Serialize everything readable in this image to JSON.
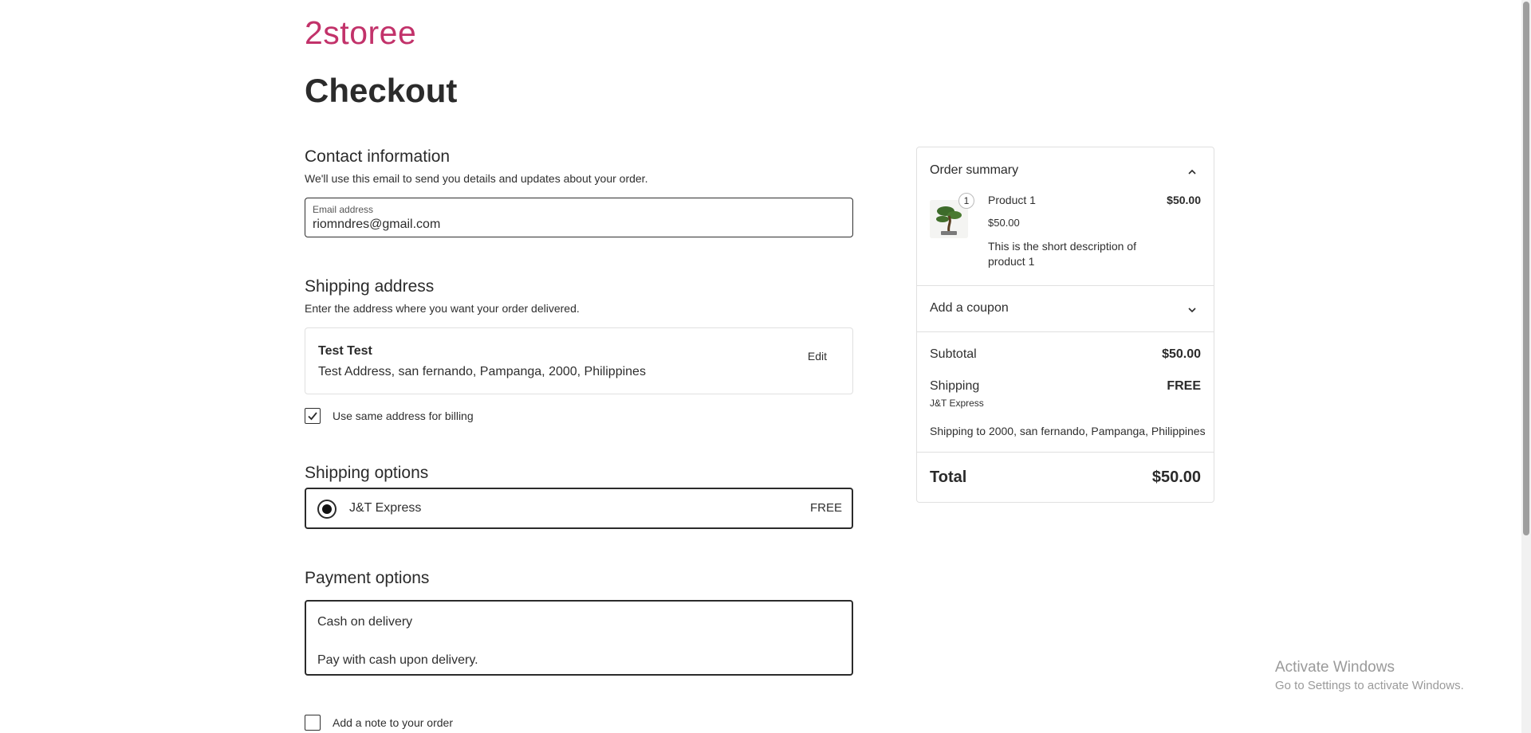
{
  "brand": "2storee",
  "page_title": "Checkout",
  "contact": {
    "title": "Contact information",
    "description": "We'll use this email to send you details and updates about your order.",
    "email_label": "Email address",
    "email_value": "riomndres@gmail.com"
  },
  "shipping_address": {
    "title": "Shipping address",
    "description": "Enter the address where you want your order delivered.",
    "name": "Test Test",
    "address": "Test Address, san fernando, Pampanga, 2000, Philippines",
    "edit_label": "Edit",
    "billing_checkbox_label": "Use same address for billing",
    "billing_checked": true
  },
  "shipping_options": {
    "title": "Shipping options",
    "option_name": "J&T Express",
    "option_price": "FREE"
  },
  "payment_options": {
    "title": "Payment options",
    "method_name": "Cash on delivery",
    "method_description": "Pay with cash upon delivery."
  },
  "note": {
    "label": "Add a note to your order",
    "checked": false
  },
  "order_summary": {
    "title": "Order summary",
    "product": {
      "name": "Product 1",
      "quantity": "1",
      "total": "$50.00",
      "price": "$50.00",
      "description": "This is the short description of product 1"
    },
    "coupon_label": "Add a coupon",
    "subtotal_label": "Subtotal",
    "subtotal_value": "$50.00",
    "shipping_label": "Shipping",
    "shipping_value": "FREE",
    "shipping_method": "J&T Express",
    "shipping_to": "Shipping to 2000, san fernando, Pampanga, Philippines",
    "total_label": "Total",
    "total_value": "$50.00"
  },
  "windows_notice": {
    "title": "Activate Windows",
    "subtitle": "Go to Settings to activate Windows."
  },
  "colors": {
    "brand": "#c2326a",
    "text": "#2f2f2f",
    "border": "#e0e0e0"
  }
}
